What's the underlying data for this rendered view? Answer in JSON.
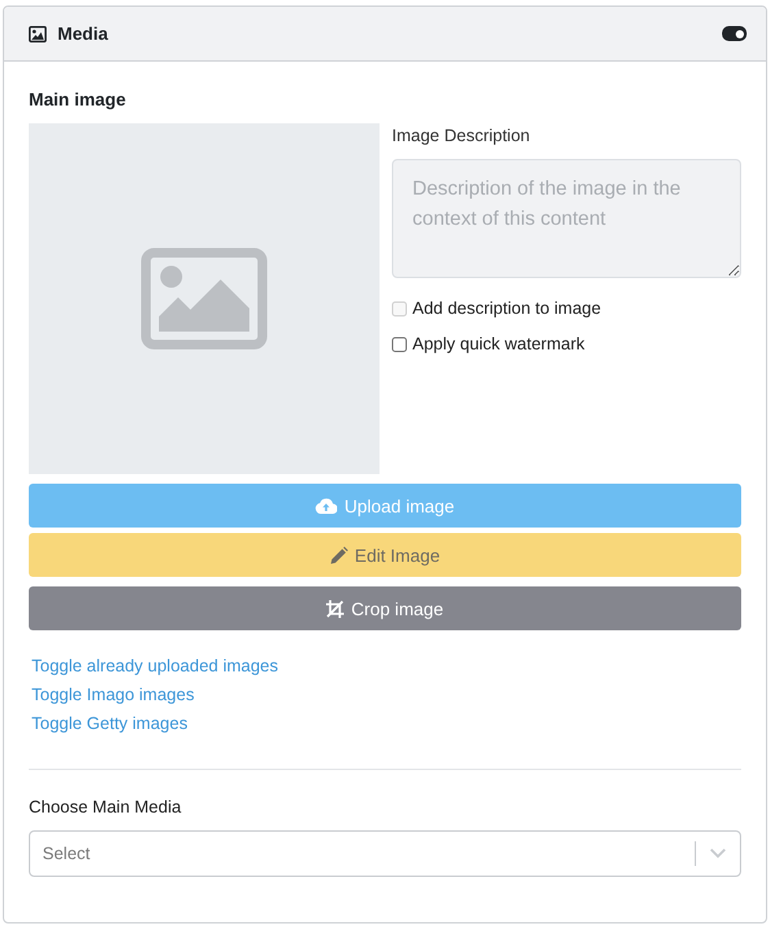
{
  "panel": {
    "title": "Media",
    "toggle": {
      "on": true
    }
  },
  "main_image": {
    "heading": "Main image",
    "preview": {
      "kind": "placeholder"
    }
  },
  "description": {
    "label": "Image Description",
    "placeholder": "Description of the image in the context of this content",
    "disabled": true
  },
  "options": [
    {
      "label": "Add description to image",
      "checked": false,
      "disabled": true
    },
    {
      "label": "Apply quick watermark",
      "checked": false,
      "disabled": false
    }
  ],
  "buttons": [
    {
      "label": "Upload image",
      "kind": "upload"
    },
    {
      "label": "Edit Image",
      "kind": "edit"
    },
    {
      "label": "Crop image",
      "kind": "crop"
    }
  ],
  "links": [
    "Toggle already uploaded images",
    "Toggle Imago images",
    "Toggle Getty images"
  ],
  "main_media": {
    "label": "Choose Main Media",
    "placeholder": "Select"
  }
}
